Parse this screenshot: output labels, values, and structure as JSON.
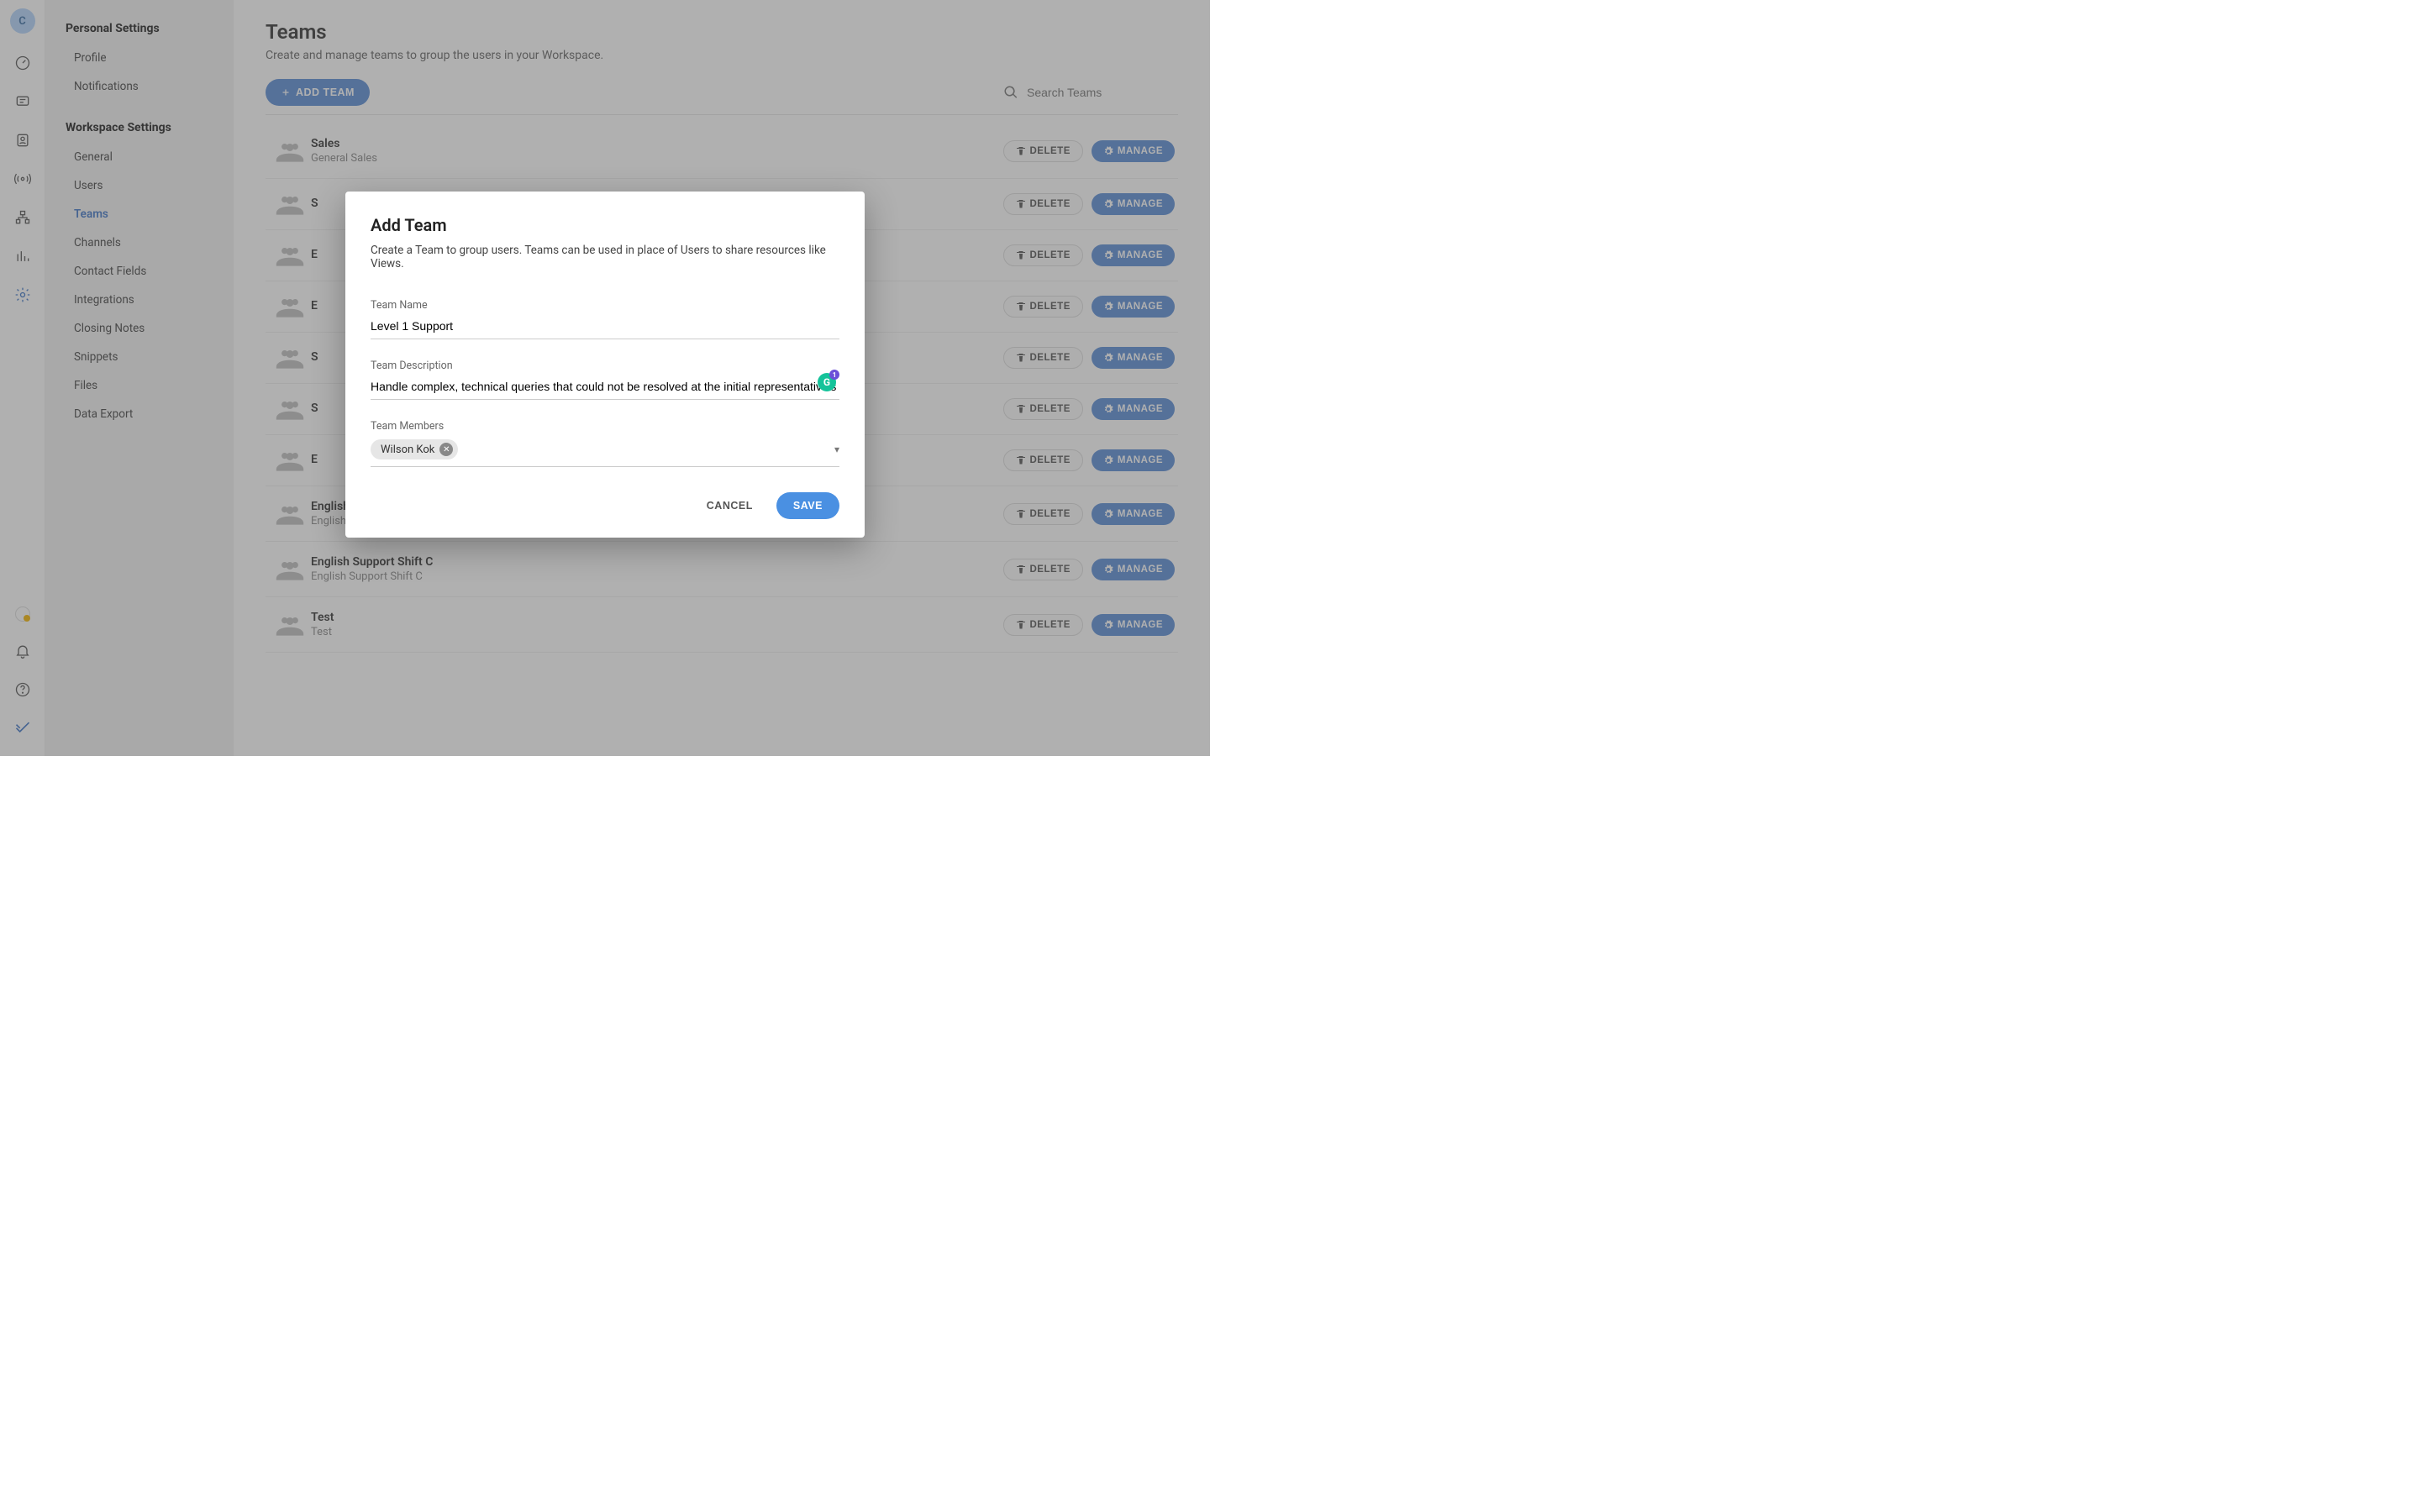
{
  "avatar_letter": "C",
  "sidebar": {
    "section1_title": "Personal Settings",
    "section1_items": [
      "Profile",
      "Notifications"
    ],
    "section2_title": "Workspace Settings",
    "section2_items": [
      "General",
      "Users",
      "Teams",
      "Channels",
      "Contact Fields",
      "Integrations",
      "Closing Notes",
      "Snippets",
      "Files",
      "Data Export"
    ],
    "active_item": "Teams"
  },
  "page": {
    "title": "Teams",
    "subtitle": "Create and manage teams to group the users in your Workspace.",
    "add_button": "ADD TEAM",
    "search_placeholder": "Search Teams"
  },
  "buttons": {
    "delete": "DELETE",
    "manage": "MANAGE"
  },
  "teams": [
    {
      "name": "Sales",
      "desc": "General Sales"
    },
    {
      "name": "S",
      "desc": ""
    },
    {
      "name": "E",
      "desc": ""
    },
    {
      "name": "E",
      "desc": ""
    },
    {
      "name": "S",
      "desc": ""
    },
    {
      "name": "S",
      "desc": ""
    },
    {
      "name": "E",
      "desc": ""
    },
    {
      "name": "English Support Shift B",
      "desc": "English Support Shift B"
    },
    {
      "name": "English Support Shift C",
      "desc": "English Support Shift C"
    },
    {
      "name": "Test",
      "desc": "Test"
    }
  ],
  "modal": {
    "title": "Add Team",
    "subtitle": "Create a Team to group users. Teams can be used in place of Users to share resources like Views.",
    "name_label": "Team Name",
    "name_value": "Level 1 Support",
    "desc_label": "Team Description",
    "desc_value": "Handle complex, technical queries that could not be resolved at the initial representative's level",
    "members_label": "Team Members",
    "member_chip": "Wilson Kok",
    "grammarly_badge": "1",
    "cancel": "CANCEL",
    "save": "SAVE"
  }
}
